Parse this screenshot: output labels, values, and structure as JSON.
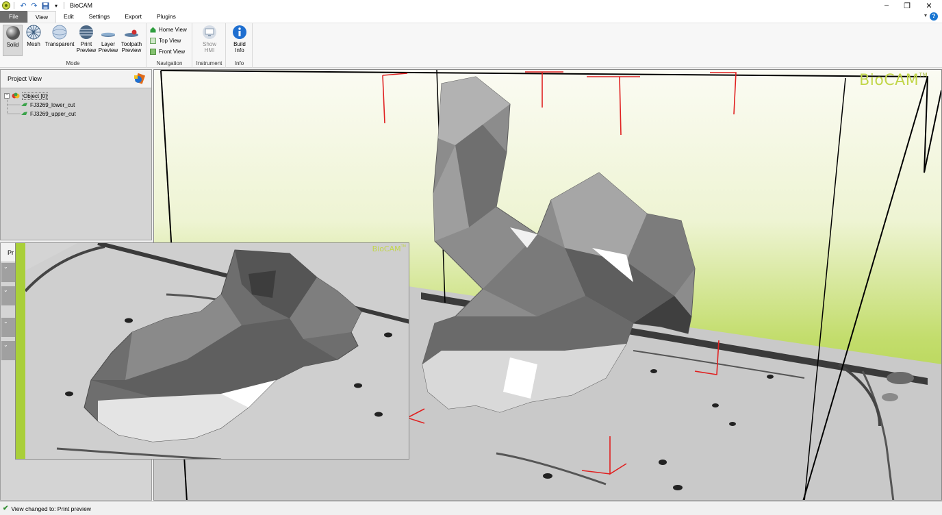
{
  "app": {
    "title": "BioCAM"
  },
  "tabs": [
    "File",
    "View",
    "Edit",
    "Settings",
    "Export",
    "Plugins"
  ],
  "ribbon": {
    "mode": {
      "label": "Mode",
      "buttons": [
        {
          "label": "Solid"
        },
        {
          "label": "Mesh"
        },
        {
          "label": "Transparent"
        },
        {
          "label": "Print",
          "label2": "Preview"
        },
        {
          "label": "Layer",
          "label2": "Preview"
        },
        {
          "label": "Toolpath",
          "label2": "Preview"
        }
      ]
    },
    "navigation": {
      "label": "Navigation",
      "items": [
        "Home View",
        "Top View",
        "Front View"
      ]
    },
    "instrument": {
      "label": "Instrument",
      "button": "Show",
      "button2": "HMI"
    },
    "info": {
      "label": "Info",
      "button": "Build",
      "button2": "Info"
    }
  },
  "project_view": {
    "title": "Project View",
    "root": "Object [0]",
    "children": [
      "FJ3269_lower_cut",
      "FJ3269_upper_cut"
    ]
  },
  "props_panel": {
    "title": "Pr"
  },
  "viewport": {
    "logo": "BioCAM",
    "tm": "TM"
  },
  "inset": {
    "logo": "BioCAM",
    "tm": "TM"
  },
  "status": {
    "text": "View changed to: Print preview"
  },
  "colors": {
    "accent": "#a9cf39",
    "brand_text": "#c2d64a",
    "axis_red": "#e02020"
  }
}
